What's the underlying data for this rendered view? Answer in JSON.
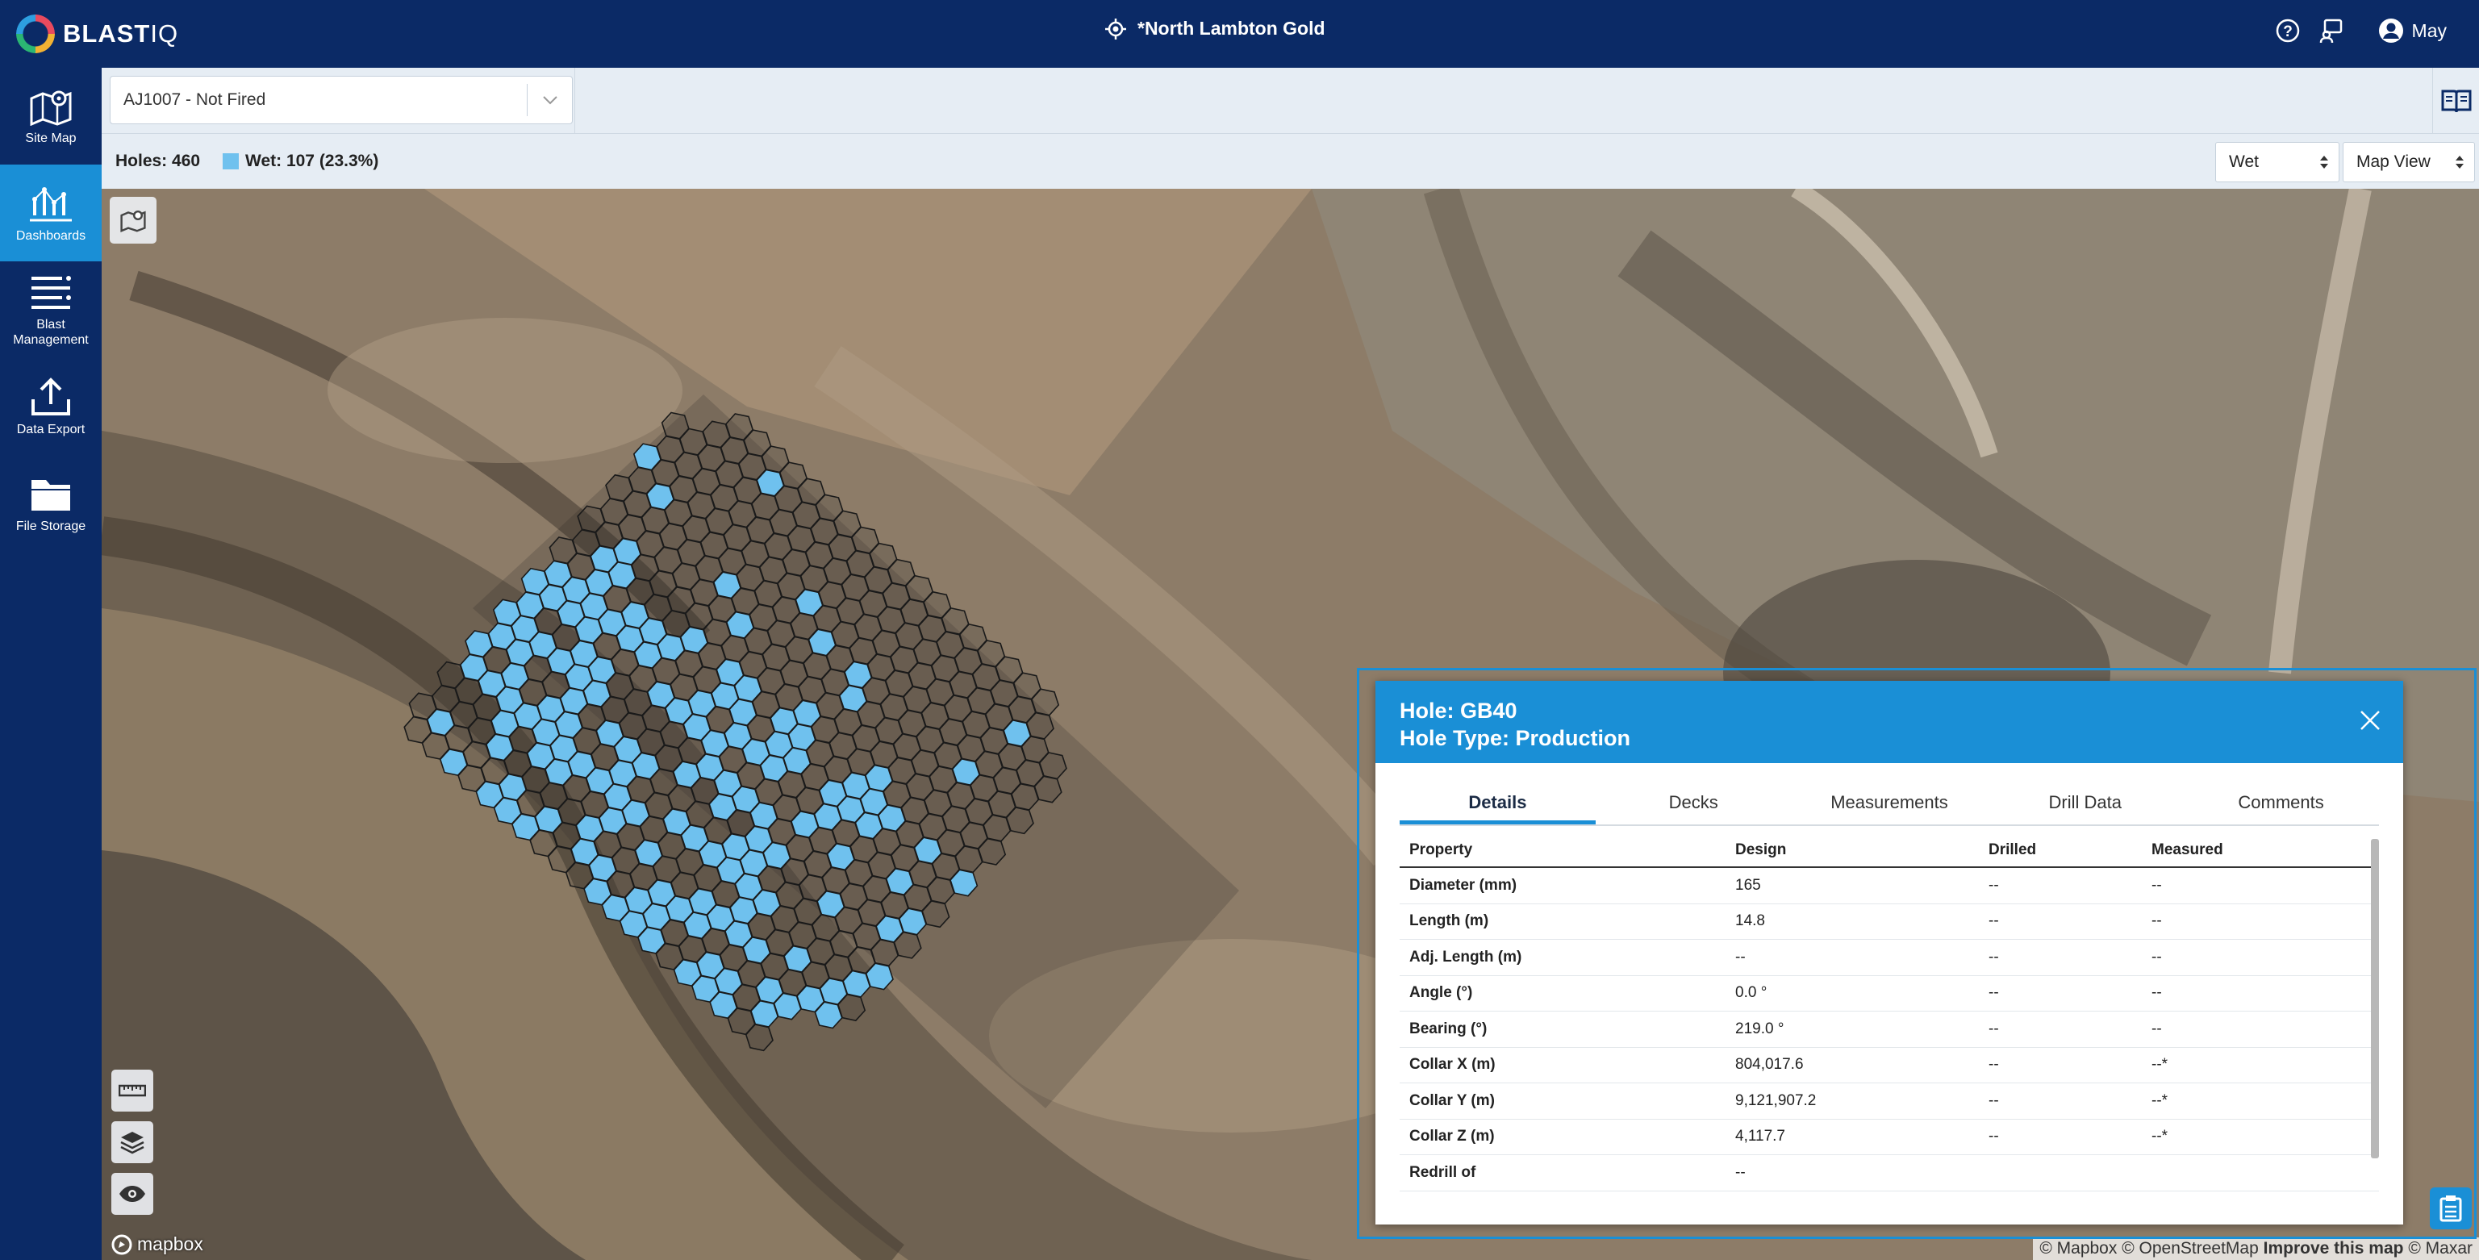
{
  "app": {
    "brand_main": "BLAST",
    "brand_suffix": "IQ",
    "site_name": "*North Lambton Gold",
    "user_name": "May"
  },
  "nav": [
    {
      "label": "Site Map",
      "icon": "map-icon"
    },
    {
      "label": "Dashboards",
      "icon": "dashboard-icon",
      "active": true
    },
    {
      "label": "Blast Management",
      "icon": "list-icon"
    },
    {
      "label": "Data Export",
      "icon": "upload-icon"
    },
    {
      "label": "File Storage",
      "icon": "folder-icon"
    }
  ],
  "toolbar": {
    "blast_selected": "AJ1007 - Not Fired"
  },
  "summary": {
    "holes": "Holes: 460",
    "wet": "Wet: 107 (23.3%)",
    "wet_color": "#6fc1ee"
  },
  "controls": {
    "property_value": "Wet",
    "view_value": "Map View"
  },
  "map": {
    "wet_color": "#6fc1ee",
    "hole_stroke": "#1a1a1a",
    "mapbox_label": "mapbox",
    "attribution_prefix": "© Mapbox © OpenStreetMap",
    "attribution_link": "Improve this map",
    "attribution_suffix": "© Maxar"
  },
  "popup": {
    "title": "Hole: GB40",
    "subtitle": "Hole Type: Production",
    "tabs": [
      "Details",
      "Decks",
      "Measurements",
      "Drill Data",
      "Comments"
    ],
    "columns": [
      "Property",
      "Design",
      "Drilled",
      "Measured"
    ],
    "rows": [
      [
        "Diameter (mm)",
        "165",
        "--",
        "--"
      ],
      [
        "Length (m)",
        "14.8",
        "--",
        "--"
      ],
      [
        "Adj. Length (m)",
        "--",
        "--",
        "--"
      ],
      [
        "Angle (°)",
        "0.0 °",
        "--",
        "--"
      ],
      [
        "Bearing (°)",
        "219.0 °",
        "--",
        "--"
      ],
      [
        "Collar X (m)",
        "804,017.6",
        "--",
        "--*"
      ],
      [
        "Collar Y (m)",
        "9,121,907.2",
        "--",
        "--*"
      ],
      [
        "Collar Z (m)",
        "4,117.7",
        "--",
        "--*"
      ],
      [
        "Redrill of",
        "--",
        "",
        ""
      ]
    ]
  }
}
